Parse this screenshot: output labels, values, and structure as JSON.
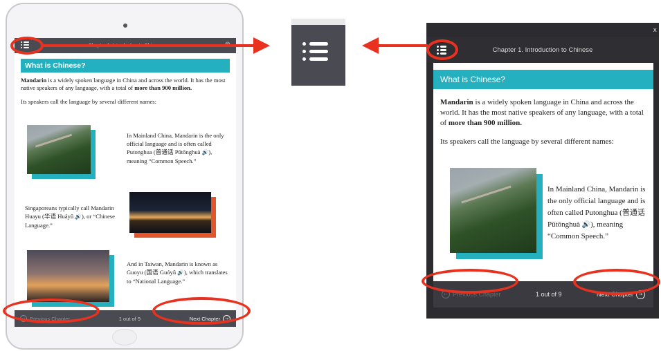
{
  "reader": {
    "chapter_title": "Chapter 1. Introduction to Chinese",
    "section_heading": "What is Chinese?",
    "intro_bold": "Mandarin",
    "intro_text": " is a widely spoken language in China and across the world. It has the most native speakers of any language, with a total of ",
    "intro_bold_end": "more than 900 million.",
    "names_text": "Its speakers call the language by several different names:",
    "para1": "In Mainland China, Mandarin is the only official language and is often called Putonghua (普通话 Pǔtōnghuà ",
    "para1_end": "), meaning “Common Speech.”",
    "para2": "Singaporeans typically call Mandarin Huayu (华语 Huáyǔ ",
    "para2_end": "), or “Chinese Language.”",
    "para3": "And in Taiwan, Mandarin is known as Guoyu (国语 Guóyǔ ",
    "para3_end": "), which translates to “National Language.”",
    "prev_label": "Previous Chapter",
    "next_label": "Next Chapter",
    "page_indicator": "1 out of 9",
    "close_glyph": "x"
  },
  "icons": {
    "menu": "menu-list-icon",
    "speaker": "speaker-icon",
    "speaker_glyph": "🔊",
    "prev": "circle-arrow-left-icon",
    "next": "circle-arrow-right-icon",
    "prev_glyph": "←",
    "next_glyph": "→"
  },
  "colors": {
    "accent": "#25b0bf",
    "bar": "#4a4a52",
    "annotation": "#e8321f"
  }
}
